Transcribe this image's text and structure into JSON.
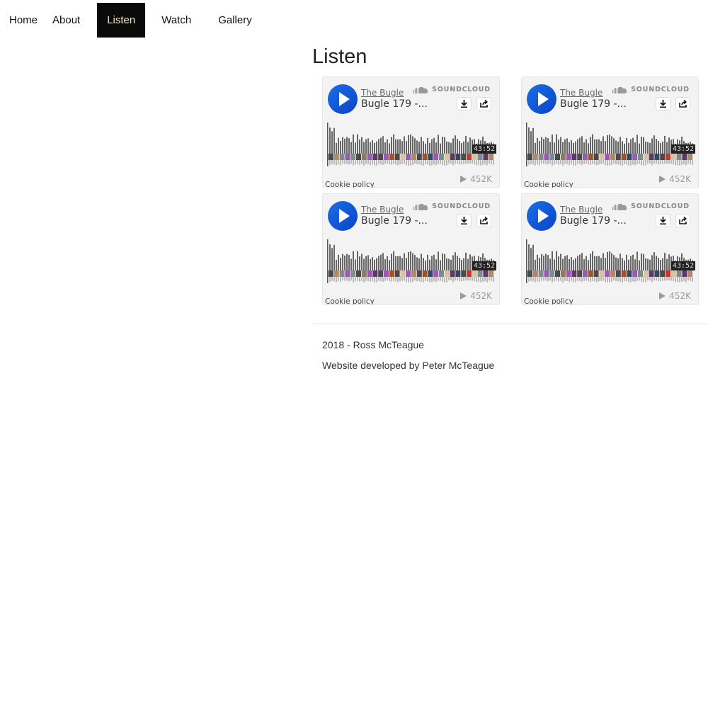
{
  "nav": {
    "items": [
      {
        "label": "Home"
      },
      {
        "label": "About"
      },
      {
        "label": "Listen"
      },
      {
        "label": "Watch"
      },
      {
        "label": "Gallery"
      }
    ],
    "active": "Listen"
  },
  "page": {
    "title": "Listen"
  },
  "widgets": [
    {
      "artist": "The Bugle",
      "track": "Bugle 179 -...",
      "brand": "SOUNDCLOUD",
      "duration": "43:52",
      "plays": "452K",
      "cookie": "Cookie policy"
    },
    {
      "artist": "The Bugle",
      "track": "Bugle 179 -...",
      "brand": "SOUNDCLOUD",
      "duration": "43:52",
      "plays": "452K",
      "cookie": "Cookie policy"
    },
    {
      "artist": "The Bugle",
      "track": "Bugle 179 -...",
      "brand": "SOUNDCLOUD",
      "duration": "43:52",
      "plays": "452K",
      "cookie": "Cookie policy"
    },
    {
      "artist": "The Bugle",
      "track": "Bugle 179 -...",
      "brand": "SOUNDCLOUD",
      "duration": "43:52",
      "plays": "452K",
      "cookie": "Cookie policy"
    }
  ],
  "icons": {
    "play": "play-icon",
    "cloud": "soundcloud-logo-icon",
    "download": "download-icon",
    "share": "share-icon",
    "plays": "play-count-icon"
  },
  "colors": {
    "nav_active_bg": "#0a0a0a",
    "nav_active_text": "#f3e9c0",
    "play_button": "#0a43c8",
    "widget_bg": "#f3f3f3",
    "waveform": "#666666"
  },
  "footer": {
    "copyright": "2018 - Ross McTeague",
    "developer": "Website developed by Peter McTeague"
  }
}
